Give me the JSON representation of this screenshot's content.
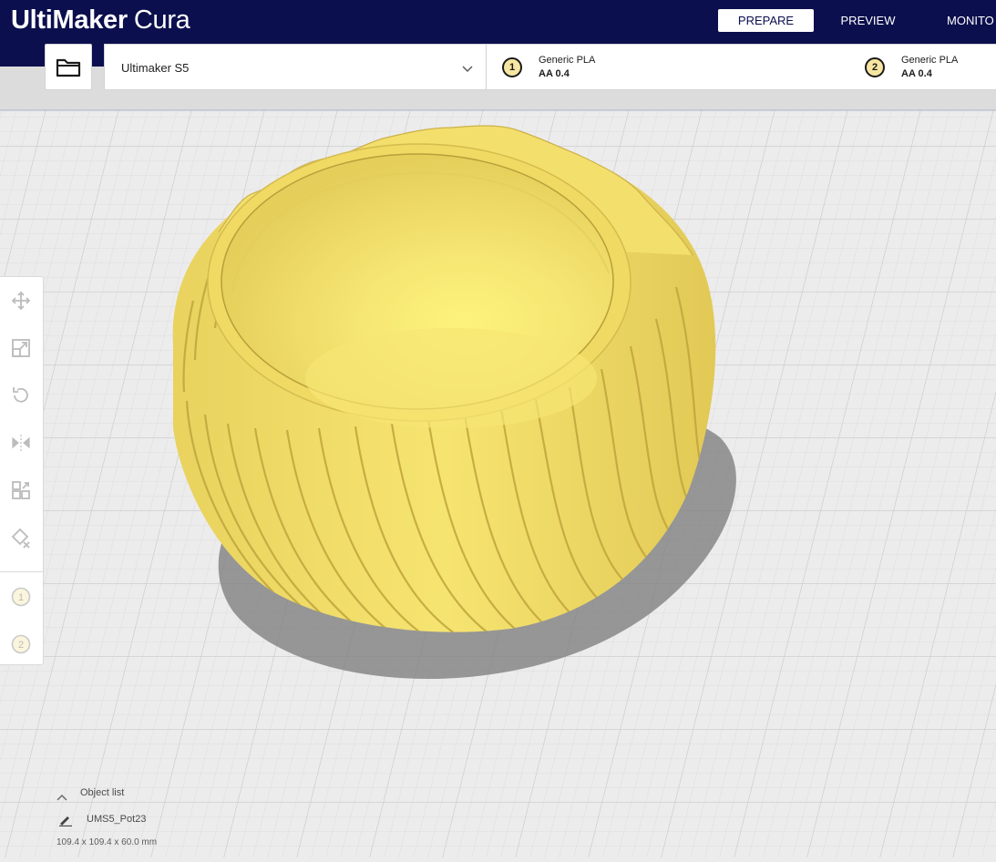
{
  "app": {
    "brand": "UltiMaker",
    "product": "Cura"
  },
  "stages": [
    {
      "label": "PREPARE",
      "active": true
    },
    {
      "label": "PREVIEW",
      "active": false
    },
    {
      "label": "MONITO",
      "active": false
    }
  ],
  "machine": {
    "name": "Ultimaker S5"
  },
  "extruders": [
    {
      "index": "1",
      "material": "Generic PLA",
      "core": "AA 0.4"
    },
    {
      "index": "2",
      "material": "Generic PLA",
      "core": "AA 0.4"
    }
  ],
  "tools": [
    {
      "icon": "move-icon"
    },
    {
      "icon": "scale-icon"
    },
    {
      "icon": "rotate-icon"
    },
    {
      "icon": "mirror-icon"
    },
    {
      "icon": "per-model-settings-icon"
    },
    {
      "icon": "support-blocker-icon"
    }
  ],
  "extruder_tools": [
    "1",
    "2"
  ],
  "object_list": {
    "label": "Object list",
    "object_name": "UMS5_Pot23",
    "dimensions": "109.4 x 109.4 x 60.0 mm"
  },
  "colors": {
    "header_bg": "#0b0f4d",
    "model_yellow": "#f3df6c",
    "build_plate": "#ececec"
  }
}
